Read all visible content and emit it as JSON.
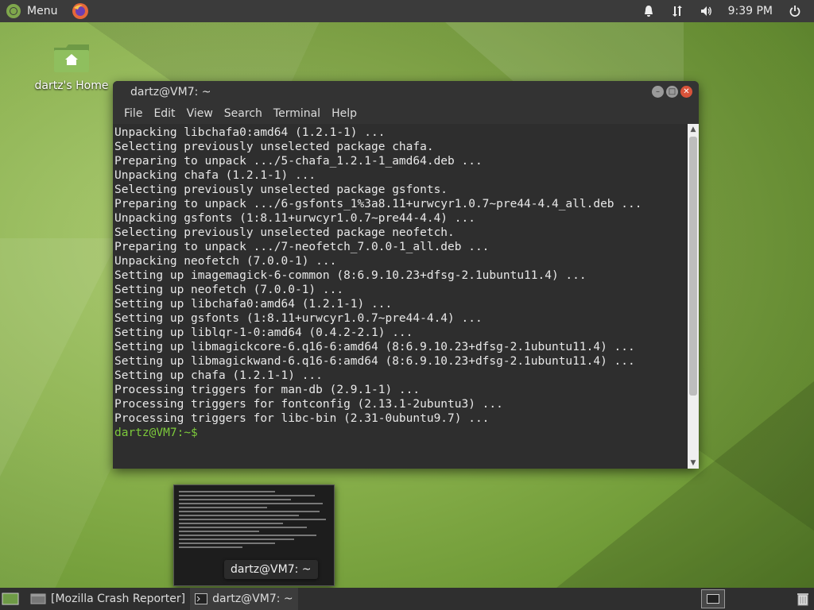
{
  "top_panel": {
    "menu_label": "Menu",
    "clock": "9:39 PM",
    "icons": [
      "mint-logo-icon",
      "firefox-icon",
      "notifications-icon",
      "network-icon",
      "volume-icon",
      "power-icon"
    ]
  },
  "desktop": {
    "home_label": "dartz's Home"
  },
  "terminal": {
    "title": "dartz@VM7: ~",
    "menu": [
      "File",
      "Edit",
      "View",
      "Search",
      "Terminal",
      "Help"
    ],
    "lines": [
      "Unpacking libchafa0:amd64 (1.2.1-1) ...",
      "Selecting previously unselected package chafa.",
      "Preparing to unpack .../5-chafa_1.2.1-1_amd64.deb ...",
      "Unpacking chafa (1.2.1-1) ...",
      "Selecting previously unselected package gsfonts.",
      "Preparing to unpack .../6-gsfonts_1%3a8.11+urwcyr1.0.7~pre44-4.4_all.deb ...",
      "Unpacking gsfonts (1:8.11+urwcyr1.0.7~pre44-4.4) ...",
      "Selecting previously unselected package neofetch.",
      "Preparing to unpack .../7-neofetch_7.0.0-1_all.deb ...",
      "Unpacking neofetch (7.0.0-1) ...",
      "Setting up imagemagick-6-common (8:6.9.10.23+dfsg-2.1ubuntu11.4) ...",
      "Setting up neofetch (7.0.0-1) ...",
      "Setting up libchafa0:amd64 (1.2.1-1) ...",
      "Setting up gsfonts (1:8.11+urwcyr1.0.7~pre44-4.4) ...",
      "Setting up liblqr-1-0:amd64 (0.4.2-2.1) ...",
      "Setting up libmagickcore-6.q16-6:amd64 (8:6.9.10.23+dfsg-2.1ubuntu11.4) ...",
      "Setting up libmagickwand-6.q16-6:amd64 (8:6.9.10.23+dfsg-2.1ubuntu11.4) ...",
      "Setting up chafa (1.2.1-1) ...",
      "Processing triggers for man-db (2.9.1-1) ...",
      "Processing triggers for fontconfig (2.13.1-2ubuntu3) ...",
      "Processing triggers for libc-bin (2.31-0ubuntu9.7) ..."
    ],
    "prompt": "dartz@VM7:~$",
    "accent": "#7cc93b"
  },
  "preview": {
    "tooltip": "dartz@VM7: ~"
  },
  "taskbar": {
    "items": [
      {
        "label": "[Mozilla Crash Reporter]"
      },
      {
        "label": "dartz@VM7: ~"
      }
    ]
  }
}
